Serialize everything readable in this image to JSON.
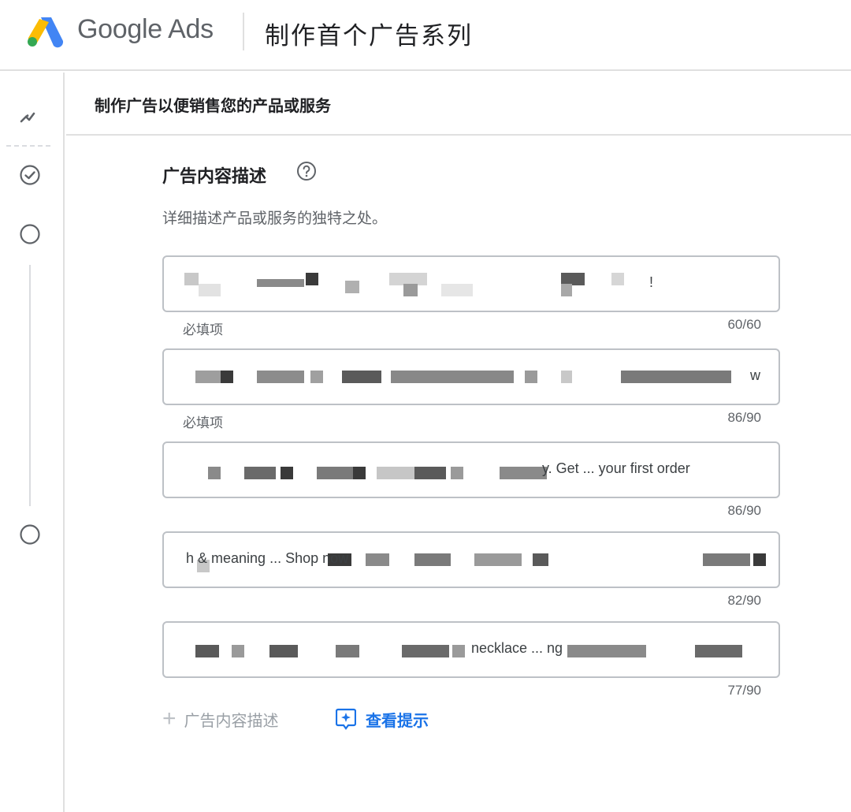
{
  "header": {
    "brand": "Google Ads",
    "title": "制作首个广告系列"
  },
  "section": {
    "title": "制作广告以便销售您的产品或服务"
  },
  "field": {
    "title": "广告内容描述",
    "description": "详细描述产品或服务的独特之处。",
    "help_icon": "help-circle-icon"
  },
  "inputs": [
    {
      "value": "",
      "visible_tail": "!",
      "required_label": "必填项",
      "count": "60/60"
    },
    {
      "value": "",
      "visible_tail": "w",
      "required_label": "必填项",
      "count": "86/90"
    },
    {
      "value": "",
      "visible_tail": "y. Get ... your first order",
      "required_label": "",
      "count": "86/90"
    },
    {
      "value": "",
      "visible_tail": "h & meaning ... Shop now",
      "required_label": "",
      "count": "82/90"
    },
    {
      "value": "",
      "visible_tail": "necklace ... ng",
      "required_label": "",
      "count": "77/90"
    }
  ],
  "actions": {
    "add_label": "广告内容描述",
    "tips_label": "查看提示"
  },
  "rail": {
    "icons": [
      "trending-icon",
      "check-circle-icon",
      "circle-icon",
      "circle-icon"
    ]
  },
  "colors": {
    "accent": "#1a73e8",
    "border": "#bdc1c6",
    "divider": "#e0e0e0",
    "muted_text": "#5f6368",
    "logo_blue": "#4285f4",
    "logo_yellow": "#fbbc04",
    "logo_green": "#34a853"
  }
}
